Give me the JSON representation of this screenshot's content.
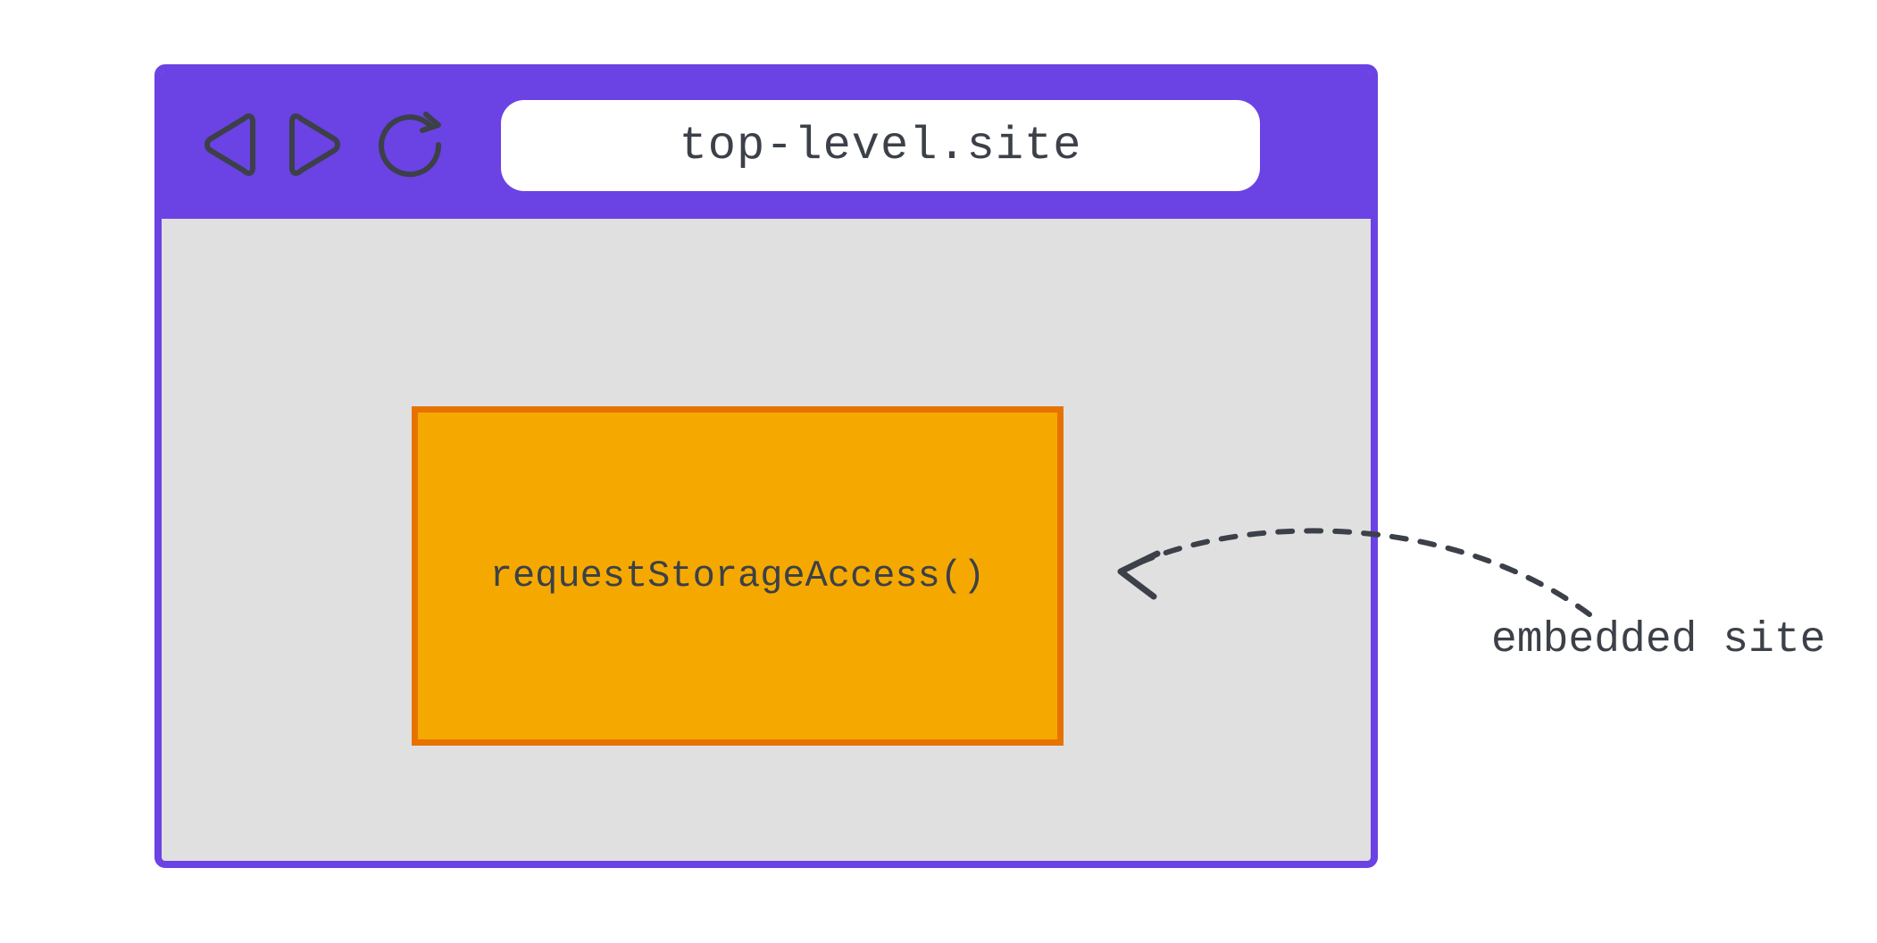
{
  "browser": {
    "url": "top-level.site"
  },
  "embed": {
    "code": "requestStorageAccess()"
  },
  "annotation": {
    "label": "embedded site"
  },
  "colors": {
    "browser_frame": "#6b42e3",
    "content_bg": "#e0e0e0",
    "embed_fill": "#f5a900",
    "embed_border": "#e67300",
    "text": "#3c4048"
  }
}
